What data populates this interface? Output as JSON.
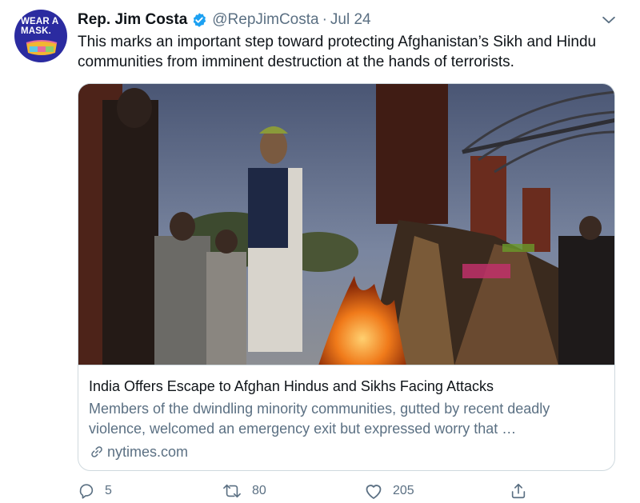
{
  "author": {
    "name": "Rep. Jim Costa",
    "handle": "@RepJimCosta",
    "date": "Jul 24",
    "avatar_text_line1": "WEAR A",
    "avatar_text_line2": "MASK.",
    "avatar_bg": "#2b2ba0"
  },
  "tweet": {
    "text": "This marks an important step toward protecting Afghanistan’s Sikh and Hindu communities from imminent destruction at the hands of terrorists."
  },
  "card": {
    "title": "India Offers Escape to Afghan Hindus and Sikhs Facing Attacks",
    "description": "Members of the dwindling minority communities, gutted by recent deadly violence, welcomed an emergency exit but expressed worry that …",
    "domain": "nytimes.com"
  },
  "actions": {
    "replies": "5",
    "retweets": "80",
    "likes": "205"
  },
  "icons": {
    "verified": "verified-badge-icon",
    "caret": "chevron-down-icon",
    "link": "link-icon",
    "reply": "reply-icon",
    "retweet": "retweet-icon",
    "like": "heart-icon",
    "share": "share-icon"
  },
  "colors": {
    "text": "#0f1419",
    "secondary": "#5b7083",
    "border": "#cfd9de",
    "verified": "#1da1f2"
  }
}
